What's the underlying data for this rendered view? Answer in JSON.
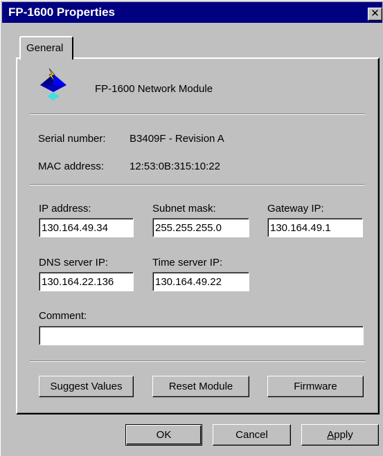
{
  "window": {
    "title": "FP-1600 Properties",
    "close_glyph": "✕",
    "title_bg": "#000080",
    "face_color": "#c0c0c0"
  },
  "tabs": [
    {
      "label": "General",
      "selected": true
    }
  ],
  "module": {
    "name": "FP-1600 Network Module",
    "icon": "network-module-icon",
    "serial_label": "Serial number:",
    "serial_value": "B3409F - Revision A",
    "mac_label": "MAC address:",
    "mac_value": "12:53:0B:315:10:22"
  },
  "network": {
    "ip_label": "IP address:",
    "ip_value": "130.164.49.34",
    "subnet_label": "Subnet mask:",
    "subnet_value": "255.255.255.0",
    "gateway_label": "Gateway IP:",
    "gateway_value": "130.164.49.1",
    "dns_label": "DNS server IP:",
    "dns_value": "130.164.22.136",
    "time_label": "Time server IP:",
    "time_value": "130.164.49.22",
    "comment_label": "Comment:",
    "comment_value": ""
  },
  "actions": {
    "suggest": "Suggest Values",
    "reset": "Reset Module",
    "firmware": "Firmware"
  },
  "footer": {
    "ok": "OK",
    "cancel": "Cancel",
    "apply_underlined": "A",
    "apply_rest": "pply"
  }
}
